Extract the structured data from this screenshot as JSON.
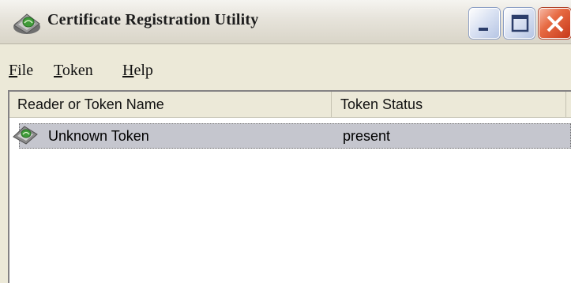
{
  "window": {
    "title": "Certificate Registration Utility",
    "icon": "token-card-icon",
    "buttons": {
      "minimize": "minimize-icon",
      "maximize": "maximize-icon",
      "close": "close-icon"
    },
    "colors": {
      "close_button": "#e0532e",
      "selection": "#c5c6ce"
    }
  },
  "menubar": {
    "items": [
      {
        "label": "File"
      },
      {
        "label": "Token"
      },
      {
        "label": "Help"
      }
    ]
  },
  "list": {
    "columns": [
      "Reader or Token Name",
      "Token Status"
    ],
    "rows": [
      {
        "name": "Unknown Token",
        "status": "present",
        "icon": "token-card-icon",
        "selected": true
      }
    ]
  }
}
